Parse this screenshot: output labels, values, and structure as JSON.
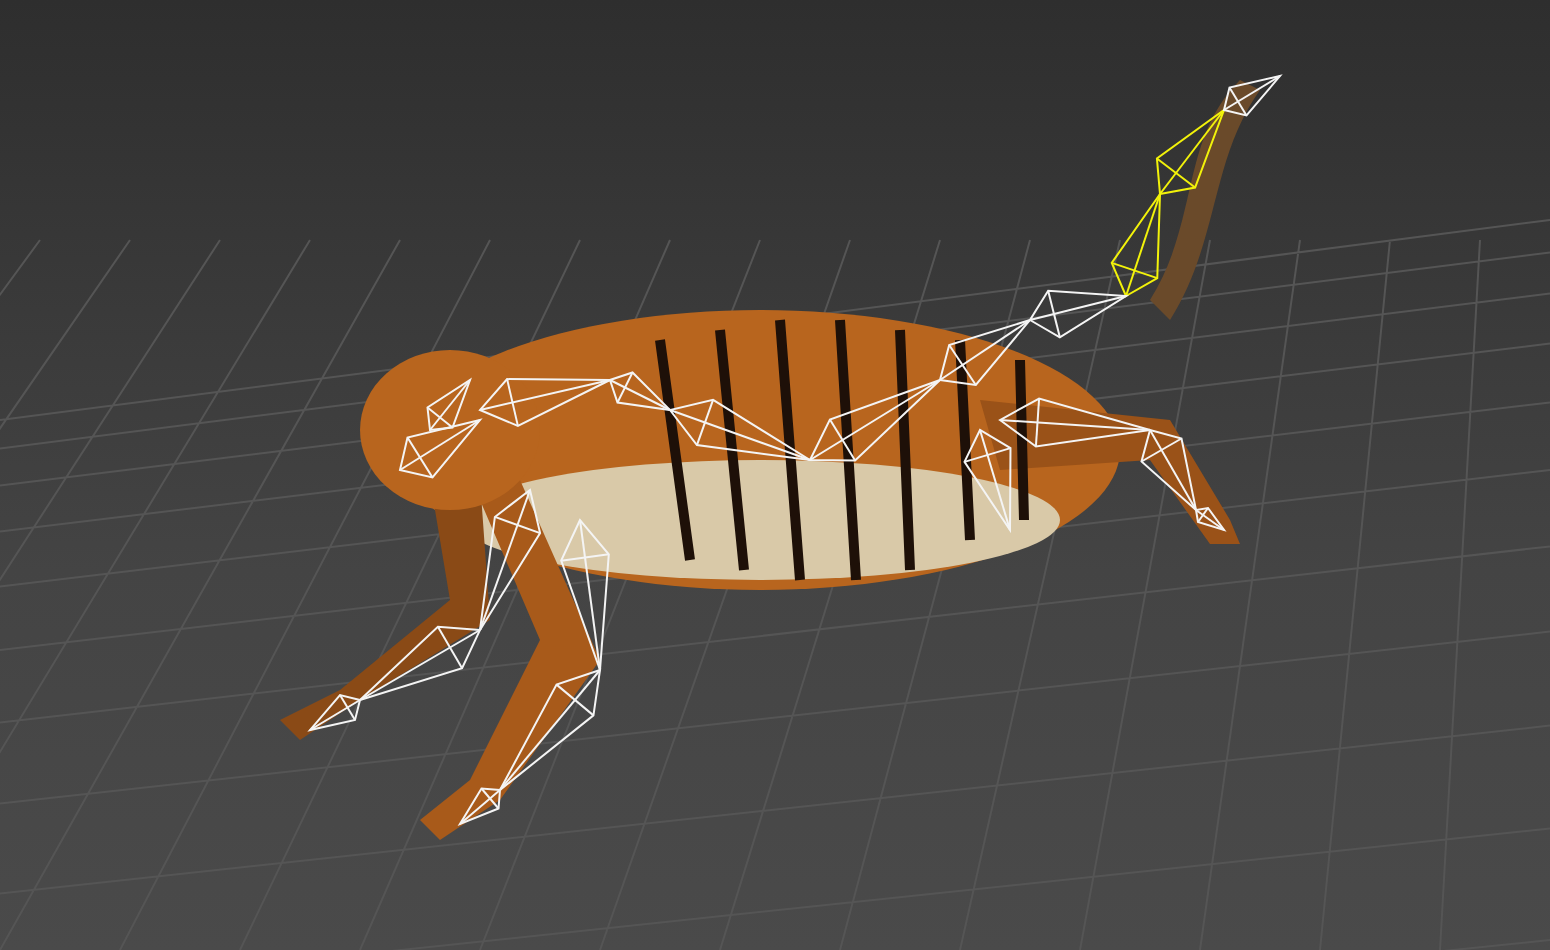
{
  "skeleton": {
    "bones": [
      {
        "selected": true
      },
      {
        "selected": true
      },
      {
        "selected": false
      },
      {
        "selected": false
      },
      {
        "selected": false
      },
      {
        "selected": false
      },
      {
        "selected": false
      },
      {
        "selected": false
      },
      {
        "selected": false
      },
      {
        "selected": false
      },
      {
        "selected": false
      },
      {
        "selected": false
      },
      {
        "selected": false
      },
      {
        "selected": false
      },
      {
        "selected": false
      },
      {
        "selected": false
      },
      {
        "selected": false
      },
      {
        "selected": false
      },
      {
        "selected": false
      },
      {
        "selected": false
      },
      {
        "selected": false
      }
    ]
  }
}
